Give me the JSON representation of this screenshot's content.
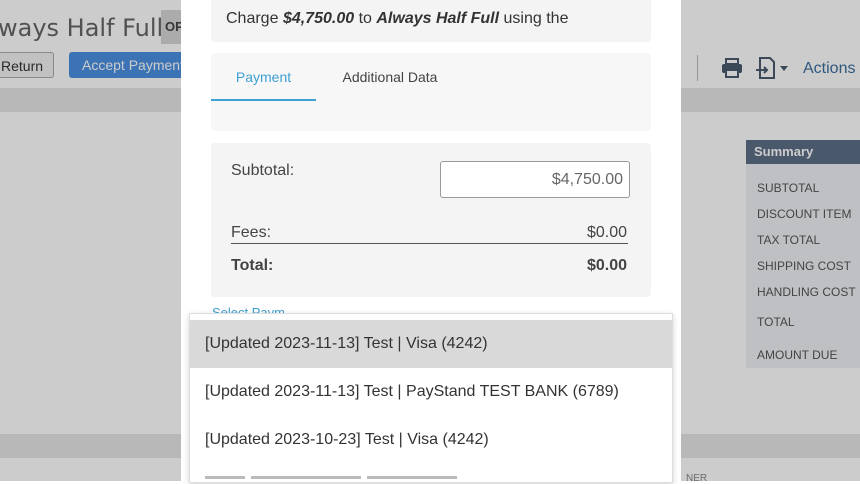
{
  "background": {
    "title": "ways Half Full",
    "status_badge": "OP",
    "return_button": "Return",
    "accept_payment_button": "Accept Payment",
    "actions_label": "Actions",
    "summary": {
      "header": "Summary",
      "rows": [
        "SUBTOTAL",
        "DISCOUNT ITEM",
        "TAX TOTAL",
        "SHIPPING COST",
        "HANDLING COST",
        "TOTAL",
        "AMOUNT DUE"
      ]
    },
    "footer_text": "NER"
  },
  "modal": {
    "charge": {
      "prefix": "Charge",
      "amount": "$4,750.00",
      "middle": "to",
      "customer": "Always Half Full",
      "suffix": "using the"
    },
    "tabs": [
      {
        "label": "Payment",
        "active": true
      },
      {
        "label": "Additional Data",
        "active": false
      }
    ],
    "totals": {
      "subtotal_label": "Subtotal:",
      "subtotal_value": "$4,750.00",
      "fees_label": "Fees:",
      "fees_value": "$0.00",
      "total_label": "Total:",
      "total_value": "$0.00"
    },
    "select_label_partial": "Select Paym"
  },
  "dropdown": {
    "options": [
      {
        "label": "[Updated 2023-11-13] Test | Visa (4242)",
        "highlighted": true
      },
      {
        "label": "[Updated 2023-11-13] Test | PayStand TEST BANK (6789)",
        "highlighted": false
      },
      {
        "label": "[Updated 2023-10-23] Test | Visa (4242)",
        "highlighted": false
      }
    ]
  },
  "colors": {
    "accent": "#3fa0d2",
    "accept_button": "#4a90e2",
    "summary_header": "#5c6f85",
    "highlight": "#d9d9d9"
  }
}
